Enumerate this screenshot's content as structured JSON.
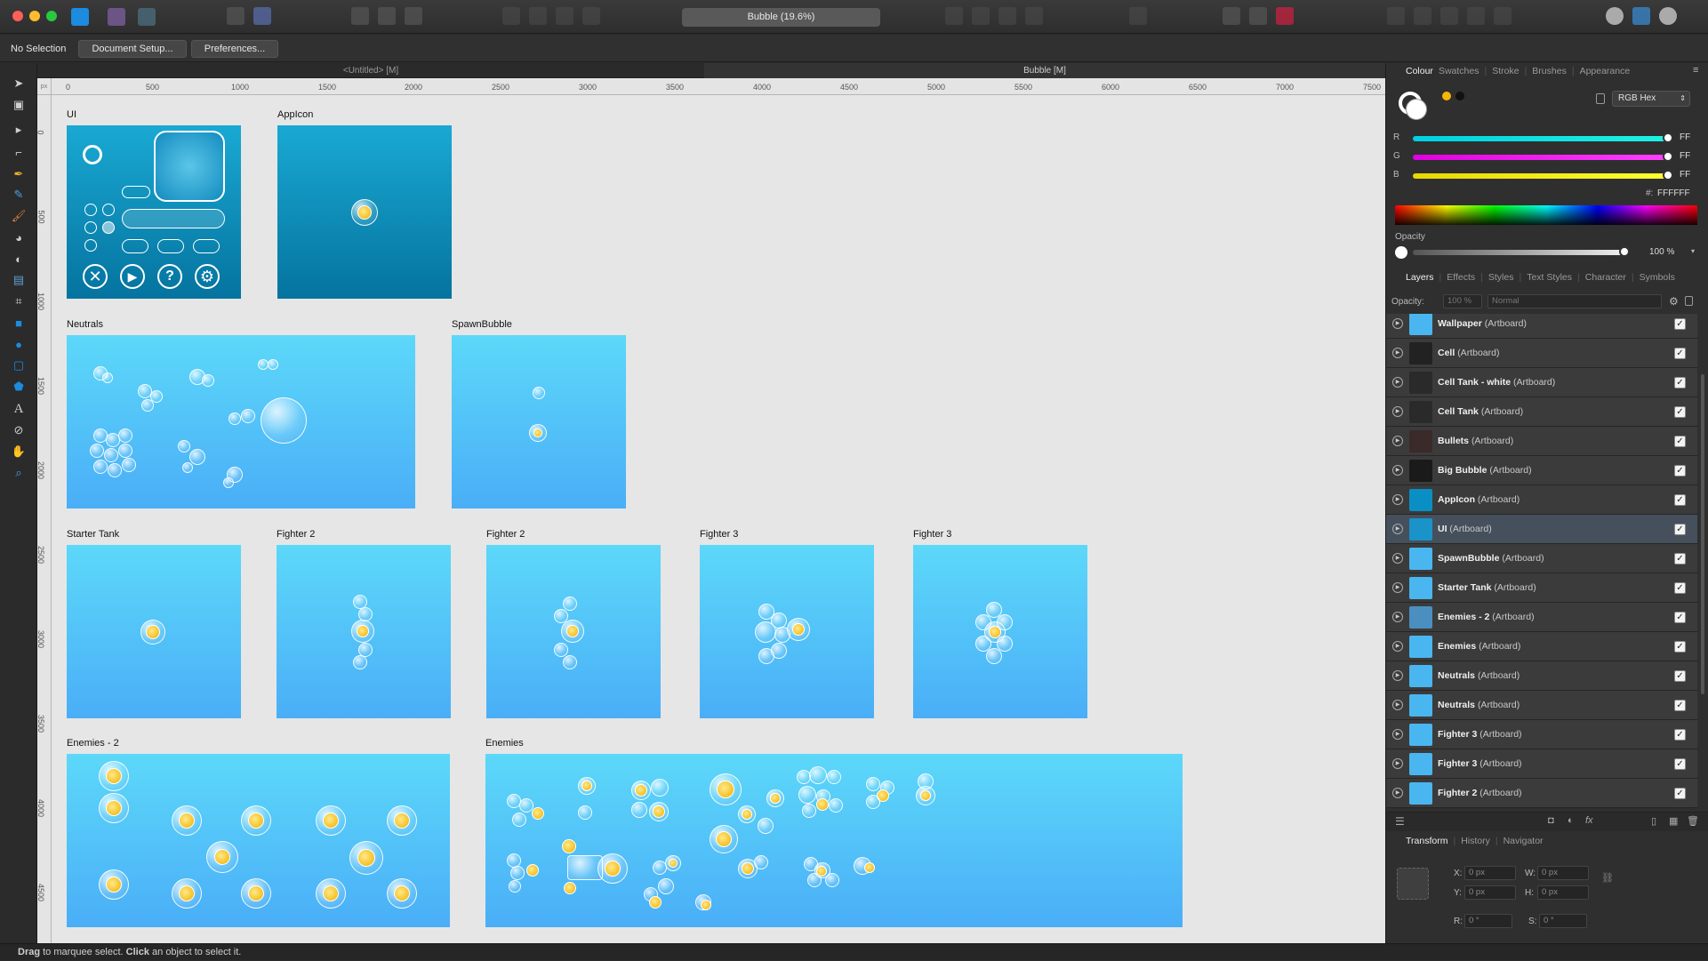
{
  "app": {
    "document_title": "Bubble (19.6%)"
  },
  "context": {
    "selection": "No Selection",
    "document_setup": "Document Setup...",
    "preferences": "Preferences..."
  },
  "tabs": [
    {
      "label": "<Untitled> [M]"
    },
    {
      "label": "Bubble [M]"
    }
  ],
  "ruler": {
    "unit": "px",
    "h_ticks": [
      "0",
      "500",
      "1000",
      "1500",
      "2000",
      "2500",
      "3000",
      "3500",
      "4000",
      "4500",
      "5000",
      "5500",
      "6000",
      "6500",
      "7000",
      "7500"
    ],
    "v_ticks": [
      "0",
      "500",
      "1000",
      "1500",
      "2000",
      "2500",
      "3000",
      "3500",
      "4000",
      "4500"
    ]
  },
  "artboards": {
    "ui": "UI",
    "appicon": "AppIcon",
    "neutrals": "Neutrals",
    "spawnbubble": "SpawnBubble",
    "starter_tank": "Starter Tank",
    "fighter2a": "Fighter 2",
    "fighter2b": "Fighter 2",
    "fighter3a": "Fighter 3",
    "fighter3b": "Fighter 3",
    "enemies2": "Enemies - 2",
    "enemies": "Enemies"
  },
  "colour_panel": {
    "tabs": [
      "Colour",
      "Swatches",
      "Stroke",
      "Brushes",
      "Appearance"
    ],
    "mode": "RGB Hex",
    "channels": [
      {
        "label": "R",
        "value": "FF",
        "color": "#00c8e0"
      },
      {
        "label": "G",
        "value": "FF",
        "color": "#e000e0"
      },
      {
        "label": "B",
        "value": "FF",
        "color": "#e8e000"
      }
    ],
    "hex_label": "#:",
    "hex_value": "FFFFFF",
    "opacity_label": "Opacity",
    "opacity_value": "100 %"
  },
  "layers_panel": {
    "tabs": [
      "Layers",
      "Effects",
      "Styles",
      "Text Styles",
      "Character",
      "Symbols"
    ],
    "opacity_label": "Opacity:",
    "opacity_value": "100 %",
    "blend_mode": "Normal",
    "rows": [
      {
        "name": "Wallpaper",
        "kind": "(Artboard)",
        "thumb": "#4ab6f0"
      },
      {
        "name": "Cell",
        "kind": "(Artboard)",
        "thumb": "#222222"
      },
      {
        "name": "Cell Tank - white",
        "kind": "(Artboard)",
        "thumb": "#2a2a2a"
      },
      {
        "name": "Cell Tank",
        "kind": "(Artboard)",
        "thumb": "#2a2a2a"
      },
      {
        "name": "Bullets",
        "kind": "(Artboard)",
        "thumb": "#3a2a2a"
      },
      {
        "name": "Big Bubble",
        "kind": "(Artboard)",
        "thumb": "#1a1a1a"
      },
      {
        "name": "AppIcon",
        "kind": "(Artboard)",
        "thumb": "#0a8fc4"
      },
      {
        "name": "UI",
        "kind": "(Artboard)",
        "thumb": "#1a93c8",
        "selected": true
      },
      {
        "name": "SpawnBubble",
        "kind": "(Artboard)",
        "thumb": "#4ab6f0"
      },
      {
        "name": "Starter Tank",
        "kind": "(Artboard)",
        "thumb": "#4ab6f0"
      },
      {
        "name": "Enemies - 2",
        "kind": "(Artboard)",
        "thumb": "#4a8fc0"
      },
      {
        "name": "Enemies",
        "kind": "(Artboard)",
        "thumb": "#4ab6f0"
      },
      {
        "name": "Neutrals",
        "kind": "(Artboard)",
        "thumb": "#4ab6f0"
      },
      {
        "name": "Neutrals",
        "kind": "(Artboard)",
        "thumb": "#4ab6f0"
      },
      {
        "name": "Fighter 3",
        "kind": "(Artboard)",
        "thumb": "#4ab6f0"
      },
      {
        "name": "Fighter 3",
        "kind": "(Artboard)",
        "thumb": "#4ab6f0"
      },
      {
        "name": "Fighter 2",
        "kind": "(Artboard)",
        "thumb": "#4ab6f0"
      }
    ]
  },
  "transform_panel": {
    "tabs": [
      "Transform",
      "History",
      "Navigator"
    ],
    "x_label": "X:",
    "x": "0 px",
    "y_label": "Y:",
    "y": "0 px",
    "w_label": "W:",
    "w": "0 px",
    "h_label": "H:",
    "h": "0 px",
    "r_label": "R:",
    "r": "0 °",
    "s_label": "S:",
    "s": "0 °"
  },
  "status": {
    "drag": "Drag",
    "drag_text": " to marquee select. ",
    "click": "Click",
    "click_text": " an object to select it."
  }
}
